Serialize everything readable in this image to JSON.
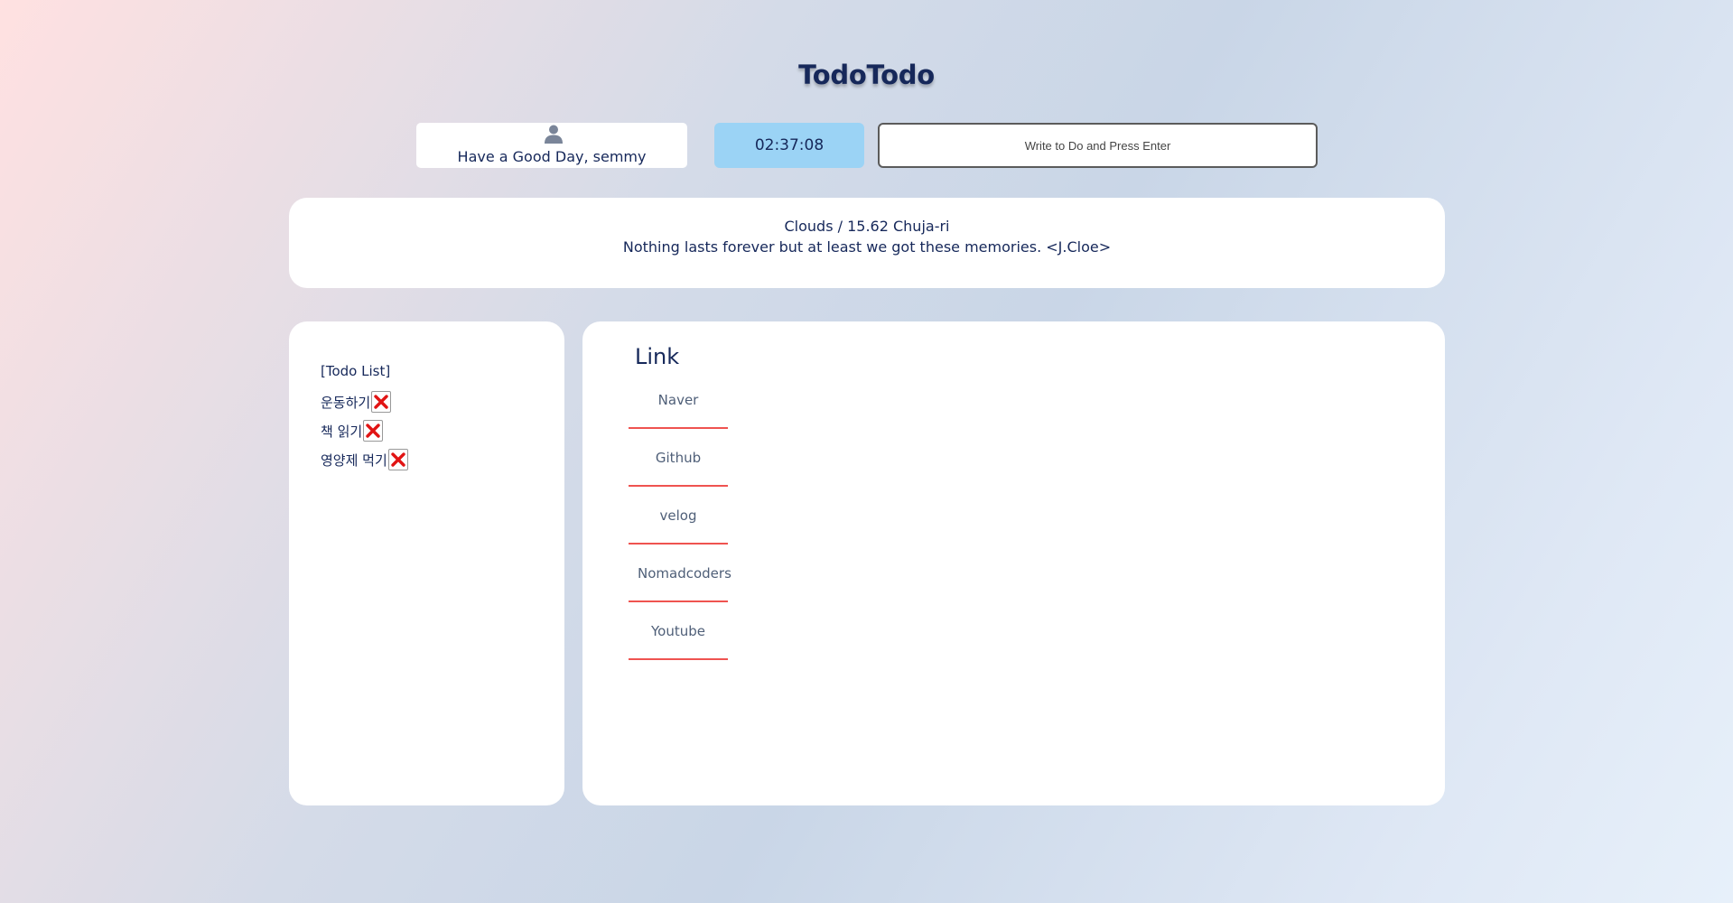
{
  "app": {
    "title": "TodoTodo"
  },
  "header": {
    "greeting": "Have a Good Day, semmy",
    "clock": "02:37:08",
    "todo_input": {
      "value": "",
      "placeholder": "Write to Do and Press Enter"
    }
  },
  "info": {
    "weather": "Clouds / 15.62 Chuja-ri",
    "quote": "Nothing lasts forever but at least we got these memories. <J.Cloe>"
  },
  "todo": {
    "heading": "[Todo List]",
    "items": [
      {
        "text": "운동하기"
      },
      {
        "text": "책 읽기"
      },
      {
        "text": "영양제 먹기"
      }
    ],
    "delete_icon": "red-x-icon"
  },
  "links": {
    "heading": "Link",
    "items": [
      {
        "label": "Naver"
      },
      {
        "label": "Github"
      },
      {
        "label": "velog"
      },
      {
        "label": "Nomadcoders"
      },
      {
        "label": "Youtube"
      }
    ]
  },
  "colors": {
    "text": "#16285a",
    "clock_bg": "#9bd3f5",
    "link_underline": "#ef5350",
    "delete_red": "#e11414",
    "user_icon": "#7a8599"
  }
}
